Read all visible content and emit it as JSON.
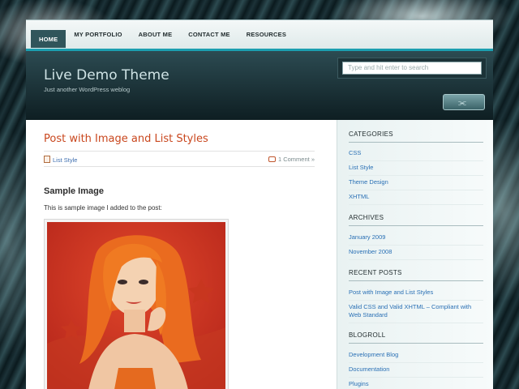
{
  "nav": {
    "items": [
      "HOME",
      "MY PORTFOLIO",
      "ABOUT ME",
      "CONTACT ME",
      "RESOURCES"
    ]
  },
  "header": {
    "site_title": "Live Demo Theme",
    "tagline": "Just another WordPress weblog",
    "search_placeholder": "Type and hit enter to search"
  },
  "post": {
    "title": "Post with Image and List Styles",
    "category": "List Style",
    "comments": "1 Comment »",
    "heading": "Sample Image",
    "paragraph": "This is sample image I added to the post:"
  },
  "sidebar": {
    "categories_title": "CATEGORIES",
    "categories": [
      "CSS",
      "List Style",
      "Theme Design",
      "XHTML"
    ],
    "archives_title": "ARCHIVES",
    "archives": [
      "January 2009",
      "November 2008"
    ],
    "recent_title": "RECENT POSTS",
    "recent": [
      "Post with Image and List Styles",
      "Valid CSS and Valid XHTML – Compliant with Web Standard"
    ],
    "blogroll_title": "BLOGROLL",
    "blogroll": [
      "Development Blog",
      "Documentation",
      "Plugins"
    ]
  },
  "colors": {
    "accent": "#c9471e",
    "link": "#2a70b5",
    "nav_active": "#30555b",
    "header_bar": "#1b9fb0"
  }
}
